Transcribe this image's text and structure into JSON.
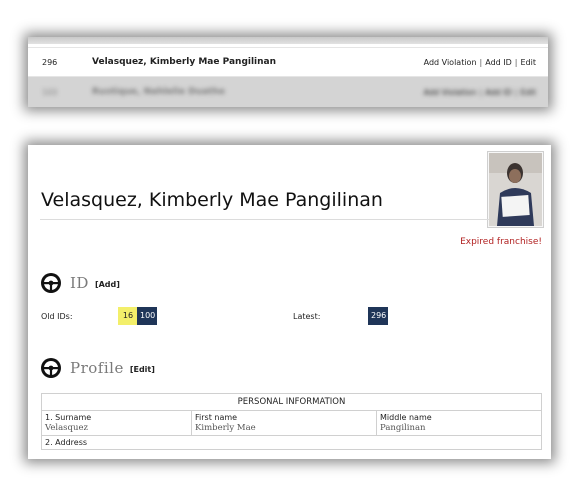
{
  "list": {
    "row1": {
      "id": "296",
      "name": "Velasquez, Kimberly Mae Pangilinan",
      "actions": [
        "Add Violation",
        "Add ID",
        "Edit"
      ]
    },
    "row2": {
      "id": "103",
      "name": "Rustique, Nahlelie Duathe",
      "actions": [
        "Add Violation",
        "Add ID",
        "Edit"
      ]
    }
  },
  "profile": {
    "name": "Velasquez, Kimberly Mae Pangilinan",
    "status": "Expired franchise!",
    "id_section": {
      "title": "ID",
      "action": "[Add]",
      "old_label": "Old IDs:",
      "old_ids": [
        "16",
        "100"
      ],
      "latest_label": "Latest:",
      "latest_id": "296"
    },
    "profile_section": {
      "title": "Profile",
      "action": "[Edit]"
    },
    "table": {
      "header": "PERSONAL INFORMATION",
      "fields": [
        {
          "label": "1. Surname",
          "value": "Velasquez"
        },
        {
          "label": "First name",
          "value": "Kimberly Mae"
        },
        {
          "label": "Middle name",
          "value": "Pangilinan"
        }
      ],
      "address_label": "2. Address"
    }
  }
}
